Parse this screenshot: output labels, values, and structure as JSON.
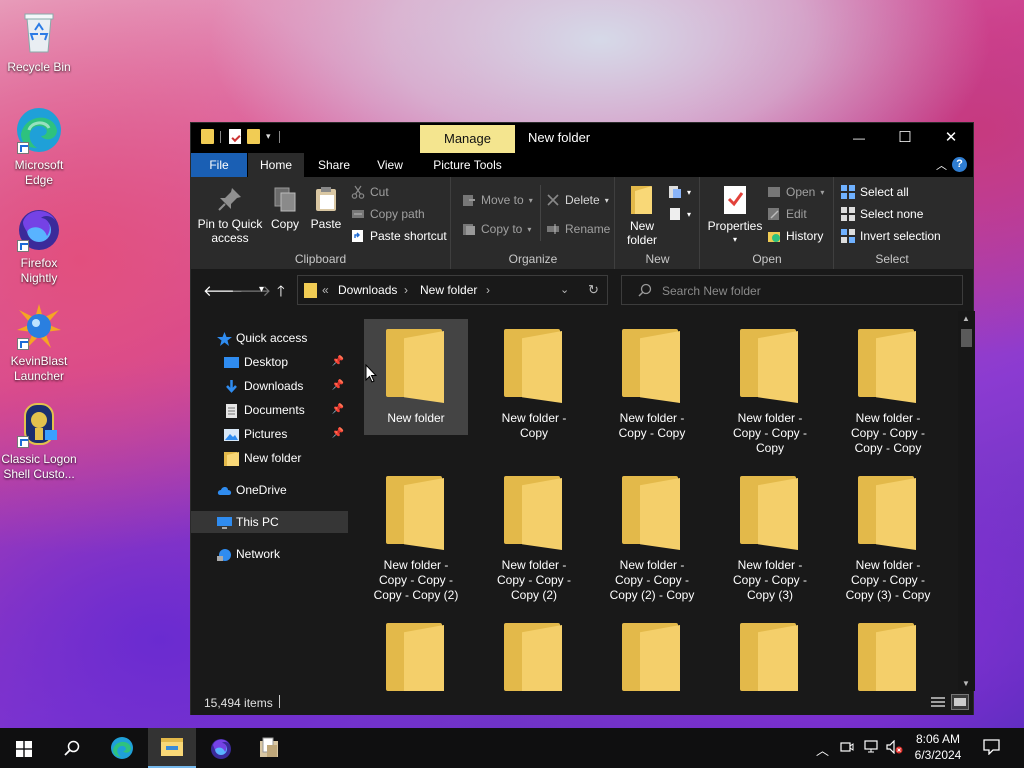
{
  "desktop": {
    "icons": [
      {
        "label": "Recycle Bin"
      },
      {
        "label": "Microsoft Edge"
      },
      {
        "label": "Firefox Nightly"
      },
      {
        "label": "KevinBlast Launcher"
      },
      {
        "label": "Classic Logon Shell Custo..."
      }
    ]
  },
  "window": {
    "title": "New folder",
    "manage_tab": "Manage",
    "tabs": {
      "file": "File",
      "home": "Home",
      "share": "Share",
      "view": "View",
      "picture_tools": "Picture Tools"
    },
    "controls": {
      "minimize": "—",
      "maximize": "☐",
      "close": "✕"
    },
    "help": "?"
  },
  "ribbon": {
    "clipboard": {
      "label": "Clipboard",
      "pin": "Pin to Quick access",
      "copy": "Copy",
      "paste": "Paste",
      "cut": "Cut",
      "copy_path": "Copy path",
      "paste_shortcut": "Paste shortcut"
    },
    "organize": {
      "label": "Organize",
      "move_to": "Move to",
      "copy_to": "Copy to",
      "delete": "Delete",
      "rename": "Rename"
    },
    "new": {
      "label": "New",
      "new_folder": "New folder"
    },
    "open": {
      "label": "Open",
      "properties": "Properties",
      "open": "Open",
      "edit": "Edit",
      "history": "History"
    },
    "select": {
      "label": "Select",
      "select_all": "Select all",
      "select_none": "Select none",
      "invert": "Invert selection"
    }
  },
  "address": {
    "prefix": "«",
    "crumbs": [
      "Downloads",
      "New folder"
    ],
    "search_placeholder": "Search New folder"
  },
  "nav": {
    "quick_access": "Quick access",
    "items": [
      "Desktop",
      "Downloads",
      "Documents",
      "Pictures",
      "New folder"
    ],
    "onedrive": "OneDrive",
    "this_pc": "This PC",
    "network": "Network"
  },
  "files": [
    [
      "New folder"
    ],
    [
      "New folder -",
      "Copy"
    ],
    [
      "New folder -",
      "Copy - Copy"
    ],
    [
      "New folder -",
      "Copy - Copy -",
      "Copy"
    ],
    [
      "New folder -",
      "Copy - Copy -",
      "Copy - Copy"
    ],
    [
      "New folder -",
      "Copy - Copy -",
      "Copy - Copy (2)"
    ],
    [
      "New folder -",
      "Copy - Copy -",
      "Copy (2)"
    ],
    [
      "New folder -",
      "Copy - Copy -",
      "Copy (2) - Copy"
    ],
    [
      "New folder -",
      "Copy - Copy -",
      "Copy (3)"
    ],
    [
      "New folder -",
      "Copy - Copy -",
      "Copy (3) - Copy"
    ],
    [
      ""
    ],
    [
      ""
    ],
    [
      ""
    ],
    [
      ""
    ],
    [
      ""
    ]
  ],
  "status": {
    "items": "15,494 items"
  },
  "taskbar": {
    "time": "8:06 AM",
    "date": "6/3/2024"
  }
}
